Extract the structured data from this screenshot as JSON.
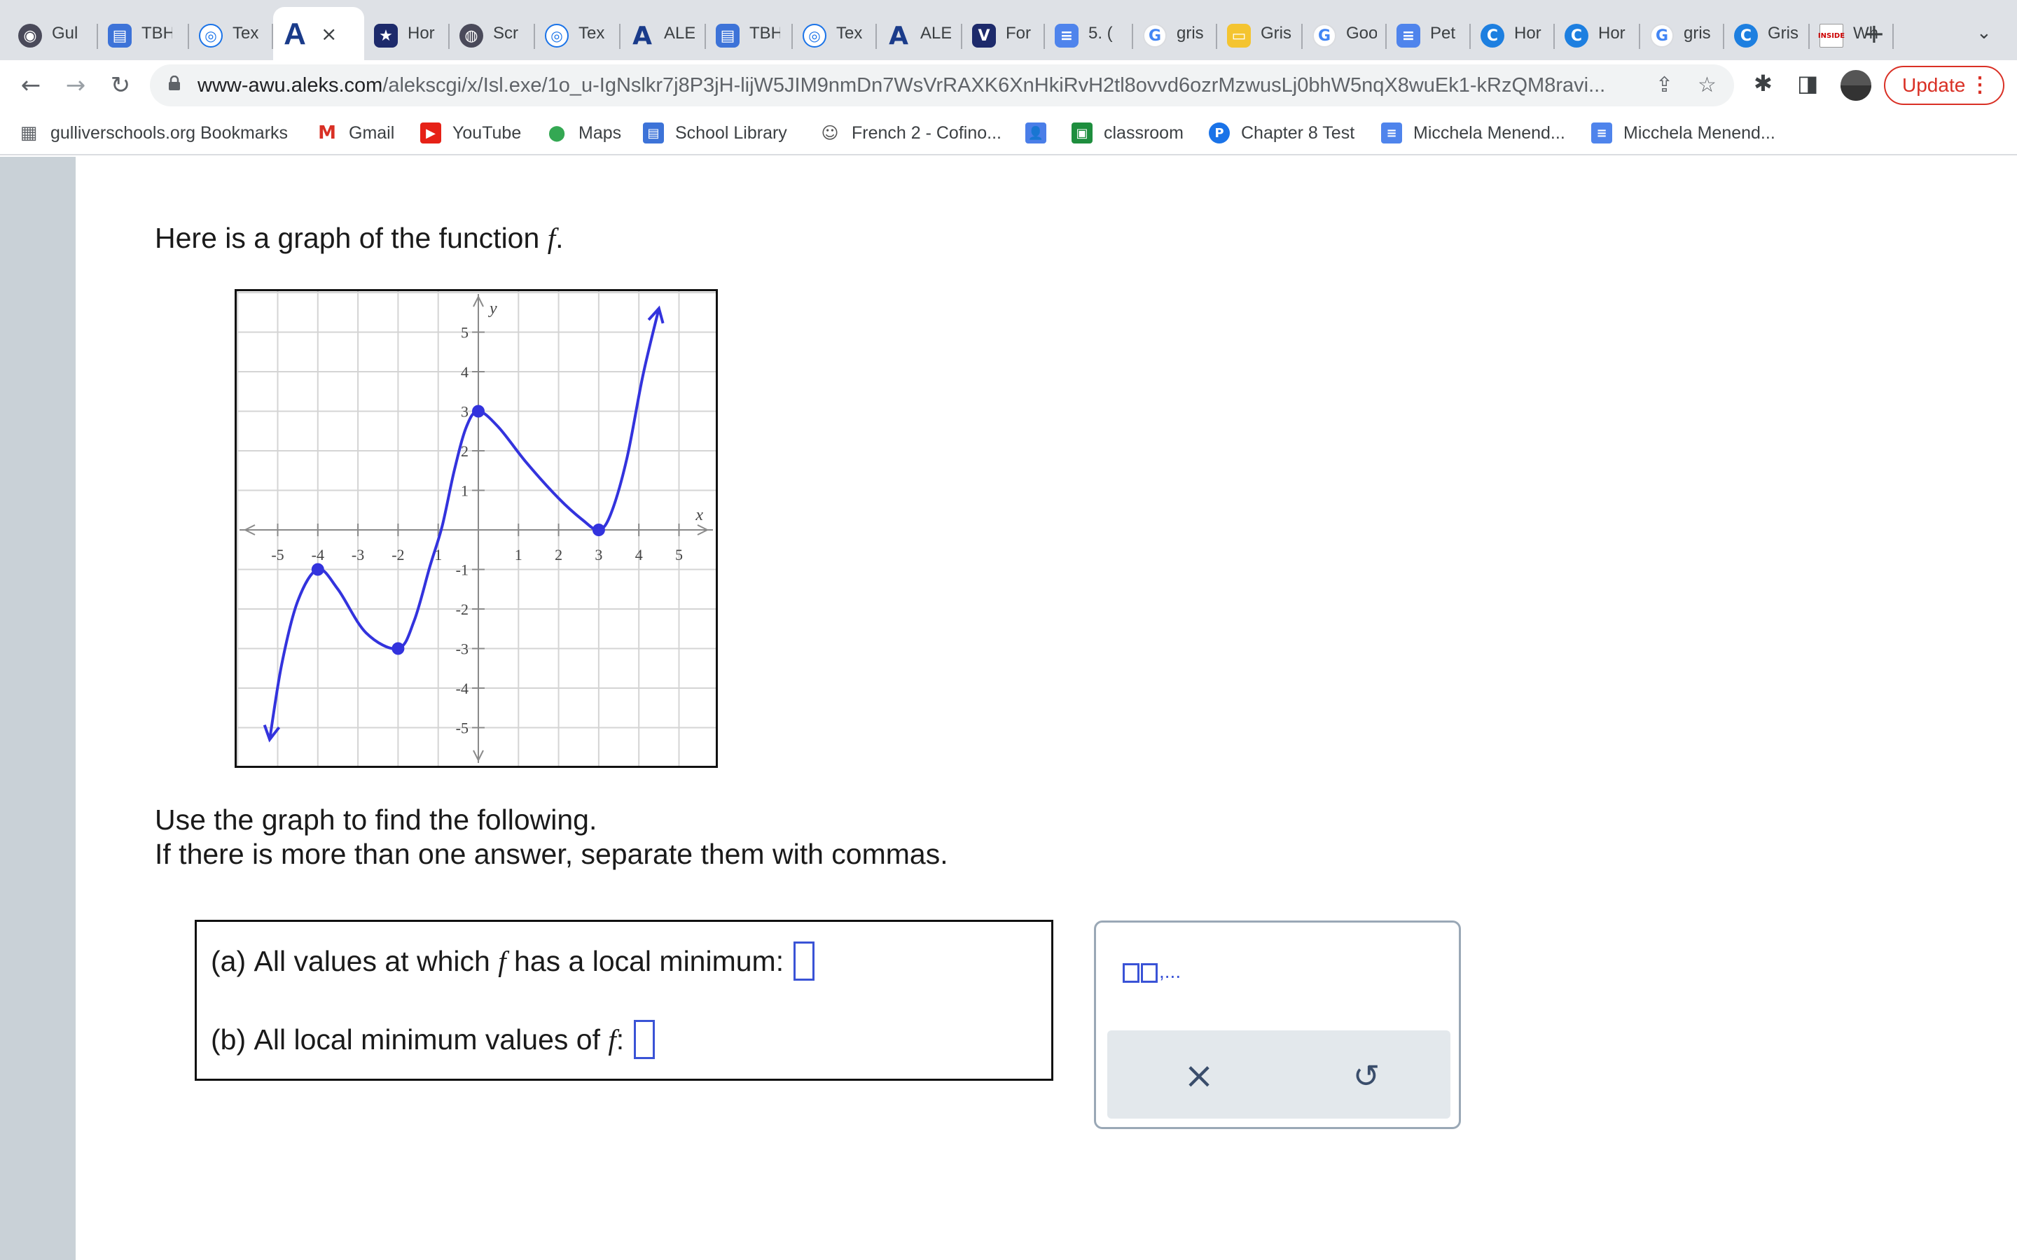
{
  "browser": {
    "tabs": [
      {
        "title": "Gul",
        "icon": "globe-dark-icon",
        "cls": "ico-dark",
        "glyph": "◉"
      },
      {
        "title": "TBH",
        "icon": "classroom-board-icon",
        "cls": "ico-blue",
        "glyph": "▤"
      },
      {
        "title": "Tex",
        "icon": "text-circle-icon",
        "cls": "ico-circ",
        "glyph": "◎"
      },
      {
        "title": "",
        "icon": "aleks-logo-icon",
        "cls": "active",
        "glyph": "A",
        "active": true
      },
      {
        "title": "Hor",
        "icon": "star-badge-icon",
        "cls": "ico-navy",
        "glyph": "★"
      },
      {
        "title": "Scr",
        "icon": "globe-icon",
        "cls": "ico-dark",
        "glyph": "◍"
      },
      {
        "title": "Tex",
        "icon": "text-circle-icon",
        "cls": "ico-circ",
        "glyph": "◎"
      },
      {
        "title": "ALE",
        "icon": "aleks-logo-icon",
        "cls": "ico-aleks",
        "glyph": "A"
      },
      {
        "title": "TBH",
        "icon": "classroom-board-icon",
        "cls": "ico-blue",
        "glyph": "▤"
      },
      {
        "title": "Tex",
        "icon": "text-circle-icon",
        "cls": "ico-circ",
        "glyph": "◎"
      },
      {
        "title": "ALE",
        "icon": "aleks-logo-icon",
        "cls": "ico-aleks",
        "glyph": "A"
      },
      {
        "title": "For",
        "icon": "v-logo-icon",
        "cls": "ico-navy",
        "glyph": "V"
      },
      {
        "title": "5. (",
        "icon": "google-doc-icon",
        "cls": "ico-doc",
        "glyph": "≡"
      },
      {
        "title": "gris",
        "icon": "google-g-icon",
        "cls": "ico-g",
        "glyph": "G"
      },
      {
        "title": "Gris",
        "icon": "slides-icon",
        "cls": "ico-yel",
        "glyph": "▭"
      },
      {
        "title": "Goo",
        "icon": "google-g-icon",
        "cls": "ico-g",
        "glyph": "G"
      },
      {
        "title": "Pet",
        "icon": "google-doc-icon",
        "cls": "ico-doc",
        "glyph": "≡"
      },
      {
        "title": "Hor",
        "icon": "c-logo-icon",
        "cls": "ico-cyan",
        "glyph": "C"
      },
      {
        "title": "Hor",
        "icon": "c-logo-icon",
        "cls": "ico-cyan",
        "glyph": "C"
      },
      {
        "title": "gris",
        "icon": "google-g-icon",
        "cls": "ico-g",
        "glyph": "G"
      },
      {
        "title": "Gris",
        "icon": "c-logo-icon",
        "cls": "ico-cyan",
        "glyph": "C"
      },
      {
        "title": "Wh",
        "icon": "inside-logo-icon",
        "cls": "ico-inside",
        "glyph": "INSIDE"
      }
    ],
    "new_tab_glyph": "+",
    "tab_search_glyph": "⌄",
    "nav": {
      "back": "←",
      "forward": "→",
      "reload": "↻"
    },
    "url_host": "www-awu.aleks.com",
    "url_path": "/alekscgi/x/Isl.exe/1o_u-IgNslkr7j8P3jH-lijW5JIM9nmDn7WsVrRAXK6XnHkiRvH2tl8ovvd6ozrMzwusLj0bhW5nqX8wuEk1-kRzQM8ravi...",
    "share_glyph": "⇪",
    "star_glyph": "☆",
    "ext_glyph": "✱",
    "sidepanel_glyph": "◨",
    "update_label": "Update",
    "menu_glyph": "⋮",
    "bookmarks": [
      {
        "label": "gulliverschools.org Bookmarks",
        "icon": "folder-icon",
        "glyph": "▦",
        "color": "#5f6368"
      },
      {
        "label": "Gmail",
        "icon": "gmail-icon",
        "glyph": "M",
        "color": "#ffffff"
      },
      {
        "label": "YouTube",
        "icon": "youtube-icon",
        "glyph": "▶",
        "color": "#e62117"
      },
      {
        "label": "Maps",
        "icon": "maps-pin-icon",
        "glyph": "⬤",
        "color": "#34a853"
      },
      {
        "label": "School Library",
        "icon": "library-icon",
        "glyph": "▤",
        "color": "#3d73d8"
      },
      {
        "label": "French 2 - Cofino...",
        "icon": "owl-icon",
        "glyph": "☺",
        "color": "#555555"
      },
      {
        "label": "",
        "icon": "contacts-icon",
        "glyph": "👤",
        "color": "#4a7ee8"
      },
      {
        "label": "classroom",
        "icon": "classroom-icon",
        "glyph": "▣",
        "color": "#1e8e3e"
      },
      {
        "label": "Chapter 8 Test",
        "icon": "p-circle-icon",
        "glyph": "P",
        "color": "#1a73e8"
      },
      {
        "label": "Micchela Menend...",
        "icon": "google-doc-icon",
        "glyph": "≡",
        "color": "#4f84ec"
      },
      {
        "label": "Micchela Menend...",
        "icon": "google-doc-icon",
        "glyph": "≡",
        "color": "#4f84ec"
      }
    ]
  },
  "question": {
    "intro": "Here is a graph of the function",
    "fn": "f",
    "period": ".",
    "instr1": "Use the graph to find the following.",
    "instr2": "If there is more than one answer, separate them with commas.",
    "part_a_label": "(a)",
    "part_a_text": "All values at which",
    "part_a_fn": "f",
    "part_a_tail": "has a local minimum:",
    "part_a_value": "",
    "part_b_label": "(b)",
    "part_b_text": "All local minimum values of",
    "part_b_fn": "f",
    "part_b_colon": ":",
    "part_b_value": ""
  },
  "keypad": {
    "template_suffix": ",...",
    "clear_glyph": "×",
    "undo_glyph": "↺"
  },
  "chart_data": {
    "type": "line",
    "title": "",
    "xlabel": "x",
    "ylabel": "y",
    "xlim": [
      -6,
      6
    ],
    "ylim": [
      -6,
      6
    ],
    "grid": true,
    "x_ticks": [
      -5,
      -4,
      -3,
      -2,
      -1,
      1,
      2,
      3,
      4,
      5
    ],
    "y_ticks": [
      -5,
      -4,
      -3,
      -2,
      -1,
      1,
      2,
      3,
      4,
      5
    ],
    "x_tick_labels": [
      "-5",
      "-4",
      "-3",
      "-2",
      "1",
      "1",
      "2",
      "3",
      "4",
      "5"
    ],
    "y_tick_labels": [
      "-5",
      "-4",
      "-3",
      "-2",
      "-1",
      "1",
      "2",
      "3",
      "4",
      "5"
    ],
    "curve_color": "#3333dd",
    "series": [
      {
        "points": [
          [
            -5.2,
            -5.3
          ],
          [
            -4.9,
            -3.4
          ],
          [
            -4.5,
            -1.8
          ],
          [
            -4,
            -1.0
          ],
          [
            -3.5,
            -1.5
          ],
          [
            -2.8,
            -2.6
          ],
          [
            -2,
            -3.0
          ],
          [
            -1.6,
            -2.3
          ],
          [
            -1.2,
            -0.9
          ],
          [
            -0.9,
            0.1
          ],
          [
            -0.6,
            1.5
          ],
          [
            -0.3,
            2.6
          ],
          [
            0,
            3.0
          ],
          [
            0.5,
            2.6
          ],
          [
            1.2,
            1.7
          ],
          [
            2.0,
            0.8
          ],
          [
            2.6,
            0.25
          ],
          [
            3,
            0.0
          ],
          [
            3.3,
            0.4
          ],
          [
            3.7,
            1.8
          ],
          [
            4.1,
            3.9
          ],
          [
            4.5,
            5.6
          ]
        ]
      }
    ],
    "marked_points": [
      [
        -4,
        -1
      ],
      [
        -2,
        -3
      ],
      [
        0,
        3
      ],
      [
        3,
        0
      ]
    ],
    "arrow_ends": [
      [
        -5.2,
        -5.3
      ],
      [
        4.5,
        5.6
      ]
    ]
  }
}
